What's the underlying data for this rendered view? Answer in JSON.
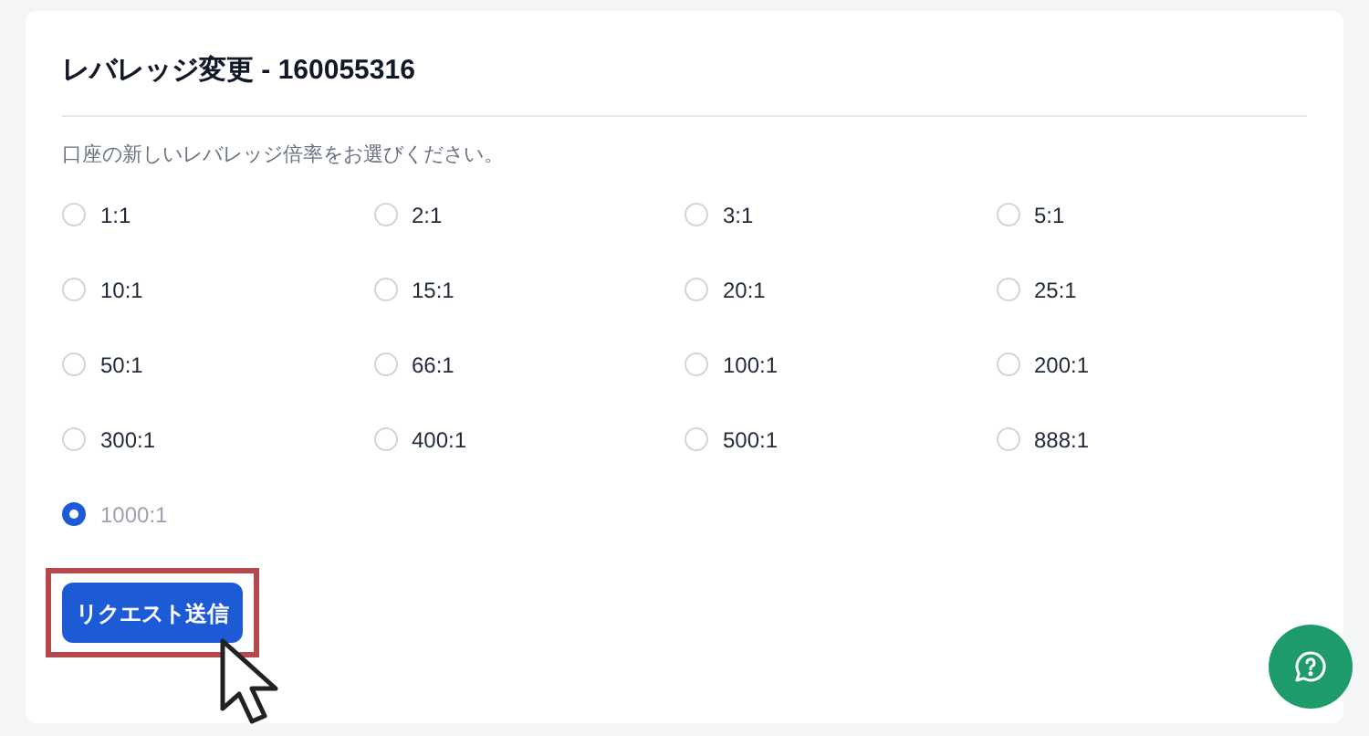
{
  "card": {
    "title": "レバレッジ変更 - 160055316",
    "instruction": "口座の新しいレバレッジ倍率をお選びください。"
  },
  "options": [
    {
      "label": "1:1",
      "selected": false
    },
    {
      "label": "2:1",
      "selected": false
    },
    {
      "label": "3:1",
      "selected": false
    },
    {
      "label": "5:1",
      "selected": false
    },
    {
      "label": "10:1",
      "selected": false
    },
    {
      "label": "15:1",
      "selected": false
    },
    {
      "label": "20:1",
      "selected": false
    },
    {
      "label": "25:1",
      "selected": false
    },
    {
      "label": "50:1",
      "selected": false
    },
    {
      "label": "66:1",
      "selected": false
    },
    {
      "label": "100:1",
      "selected": false
    },
    {
      "label": "200:1",
      "selected": false
    },
    {
      "label": "300:1",
      "selected": false
    },
    {
      "label": "400:1",
      "selected": false
    },
    {
      "label": "500:1",
      "selected": false
    },
    {
      "label": "888:1",
      "selected": false
    },
    {
      "label": "1000:1",
      "selected": true
    }
  ],
  "submit_button": {
    "label": "リクエスト送信",
    "highlighted": true
  }
}
